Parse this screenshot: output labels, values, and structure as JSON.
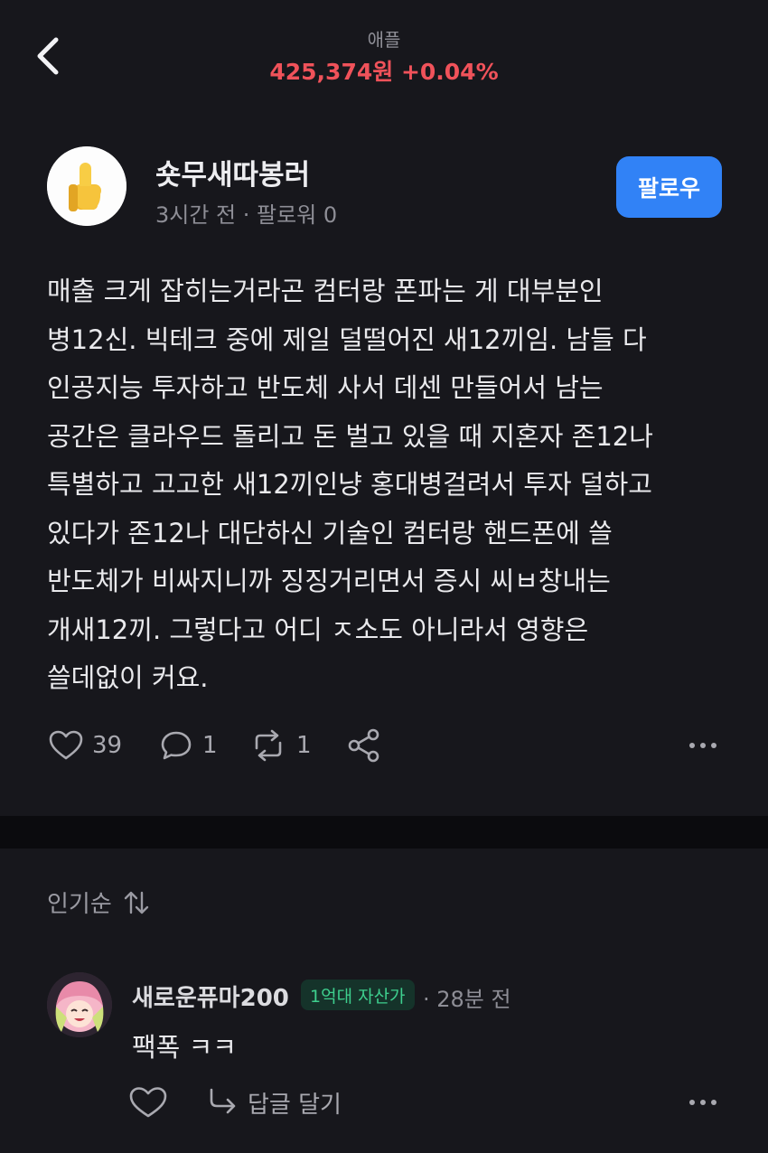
{
  "header": {
    "stock_name": "애플",
    "stock_price": "425,374원 +0.04%",
    "back_icon": "chevron-left-icon"
  },
  "author": {
    "name": "숏무새따봉러",
    "meta": "3시간 전 · 팔로워 0",
    "avatar_icon": "thumbs-up-icon",
    "follow_label": "팔로우"
  },
  "post": {
    "lines": [
      "매출 크게 잡히는거라곤 컴터랑 폰파는 게 대부분인",
      "병12신. 빅테크 중에 제일 덜떨어진 새12끼임. 남들 다",
      "인공지능 투자하고 반도체 사서 데센 만들어서 남는",
      "공간은 클라우드 돌리고 돈 벌고 있을 때 지혼자 존12나",
      "특별하고 고고한 새12끼인냥 홍대병걸려서 투자 덜하고",
      "있다가 존12나 대단하신 기술인 컴터랑 핸드폰에 쓸",
      "반도체가 비싸지니까 징징거리면서 증시 씨ㅂ창내는",
      "개새12끼. 그렇다고 어디 ㅈ소도 아니라서 영향은",
      "쓸데없이 커요."
    ]
  },
  "actions": {
    "likes": "39",
    "comments": "1",
    "reposts": "1"
  },
  "comments_section": {
    "sort_label": "인기순",
    "items": [
      {
        "name": "새로운퓨마200",
        "badge": "1억대 자산가",
        "time": "· 28분 전",
        "text": "팩폭 ㅋㅋ",
        "reply_label": "답글 달기"
      }
    ]
  },
  "colors": {
    "background": "#17171c",
    "price_up": "#f0525a",
    "follow_button": "#3182f6",
    "badge_text": "#3ecf8e",
    "badge_bg": "#15332a"
  }
}
